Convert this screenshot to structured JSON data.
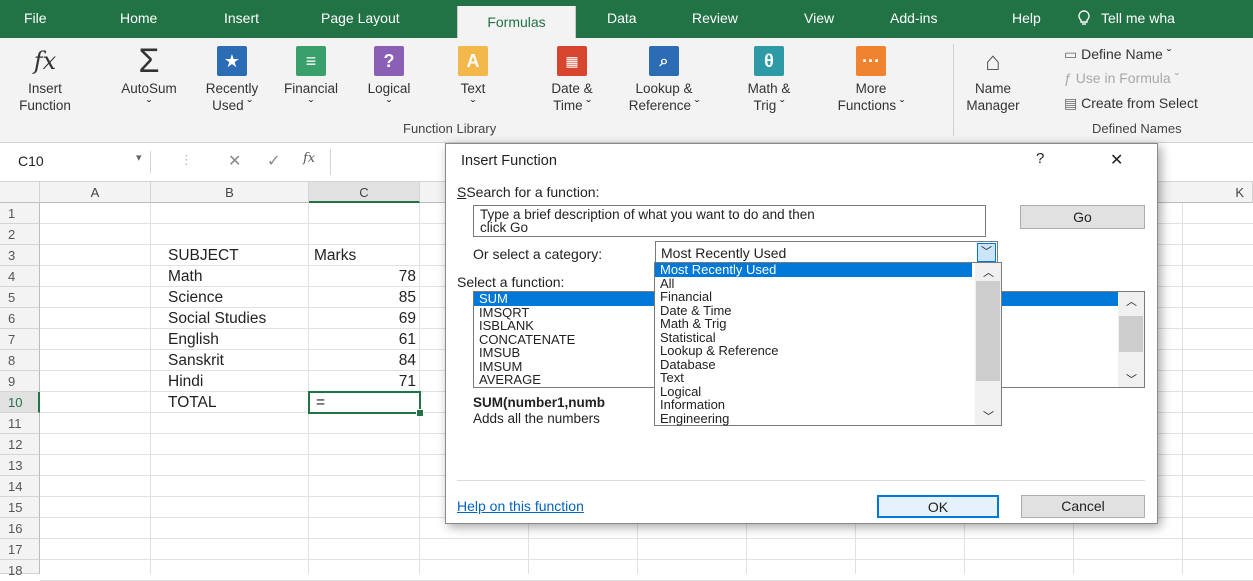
{
  "ribbon": {
    "tabs": [
      "File",
      "Home",
      "Insert",
      "Page Layout",
      "Formulas",
      "Data",
      "Review",
      "View",
      "Add-ins",
      "Help"
    ],
    "tell_me": "Tell me wha",
    "buttons": {
      "insert_function": [
        "Insert",
        "Function"
      ],
      "autosum": [
        "AutoSum",
        "ˇ"
      ],
      "recently_used": [
        "Recently",
        "Used ˇ"
      ],
      "financial": [
        "Financial",
        "ˇ"
      ],
      "logical": [
        "Logical",
        "ˇ"
      ],
      "text": [
        "Text",
        "ˇ"
      ],
      "date_time": [
        "Date &",
        "Time ˇ"
      ],
      "lookup": [
        "Lookup &",
        "Reference ˇ"
      ],
      "math_trig": [
        "Math &",
        "Trig ˇ"
      ],
      "more_functions": [
        "More",
        "Functions ˇ"
      ],
      "name_manager": [
        "Name",
        "Manager"
      ]
    },
    "function_library_label": "Function Library",
    "defined_names": {
      "define_name": "Define Name  ˇ",
      "use_in_formula": "Use in Formula ˇ",
      "create_from_selection": "Create from Select",
      "label": "Defined Names"
    }
  },
  "formula_bar": {
    "name_box": "C10",
    "fx": "fx"
  },
  "sheet": {
    "columns": [
      "A",
      "B",
      "C",
      "K"
    ],
    "rows": [
      "1",
      "2",
      "3",
      "4",
      "5",
      "6",
      "7",
      "8",
      "9",
      "10",
      "11",
      "12",
      "13",
      "14",
      "15",
      "16",
      "17",
      "18"
    ],
    "header": {
      "subject": "SUBJECT",
      "marks": "Marks"
    },
    "data": [
      {
        "subject": "Math",
        "marks": "78"
      },
      {
        "subject": "Science",
        "marks": "85"
      },
      {
        "subject": "Social Studies",
        "marks": "69"
      },
      {
        "subject": "English",
        "marks": "61"
      },
      {
        "subject": "Sanskrit",
        "marks": "84"
      },
      {
        "subject": "Hindi",
        "marks": "71"
      }
    ],
    "total_label": "TOTAL",
    "active_cell_value": "="
  },
  "dialog": {
    "title": "Insert Function",
    "help": "?",
    "close": "✕",
    "search_label": "Search for a function:",
    "search_text_1": "Type a brief description of what you want to do and then",
    "search_text_2": "click Go",
    "go": "Go",
    "category_label": "Or select a category:",
    "category_value": "Most Recently Used",
    "select_label": "Select a function:",
    "functions": [
      "SUM",
      "IMSQRT",
      "ISBLANK",
      "CONCATENATE",
      "IMSUB",
      "IMSUM",
      "AVERAGE"
    ],
    "categories": [
      "Most Recently Used",
      "All",
      "Financial",
      "Date & Time",
      "Math & Trig",
      "Statistical",
      "Lookup & Reference",
      "Database",
      "Text",
      "Logical",
      "Information",
      "Engineering"
    ],
    "syntax": "SUM(number1,numb",
    "description": "Adds all the numbers",
    "help_link": "Help on this function",
    "ok": "OK",
    "cancel": "Cancel"
  },
  "colors": {
    "excel_green": "#217346",
    "selection_blue": "#0078d7",
    "link_blue": "#0563c1"
  }
}
